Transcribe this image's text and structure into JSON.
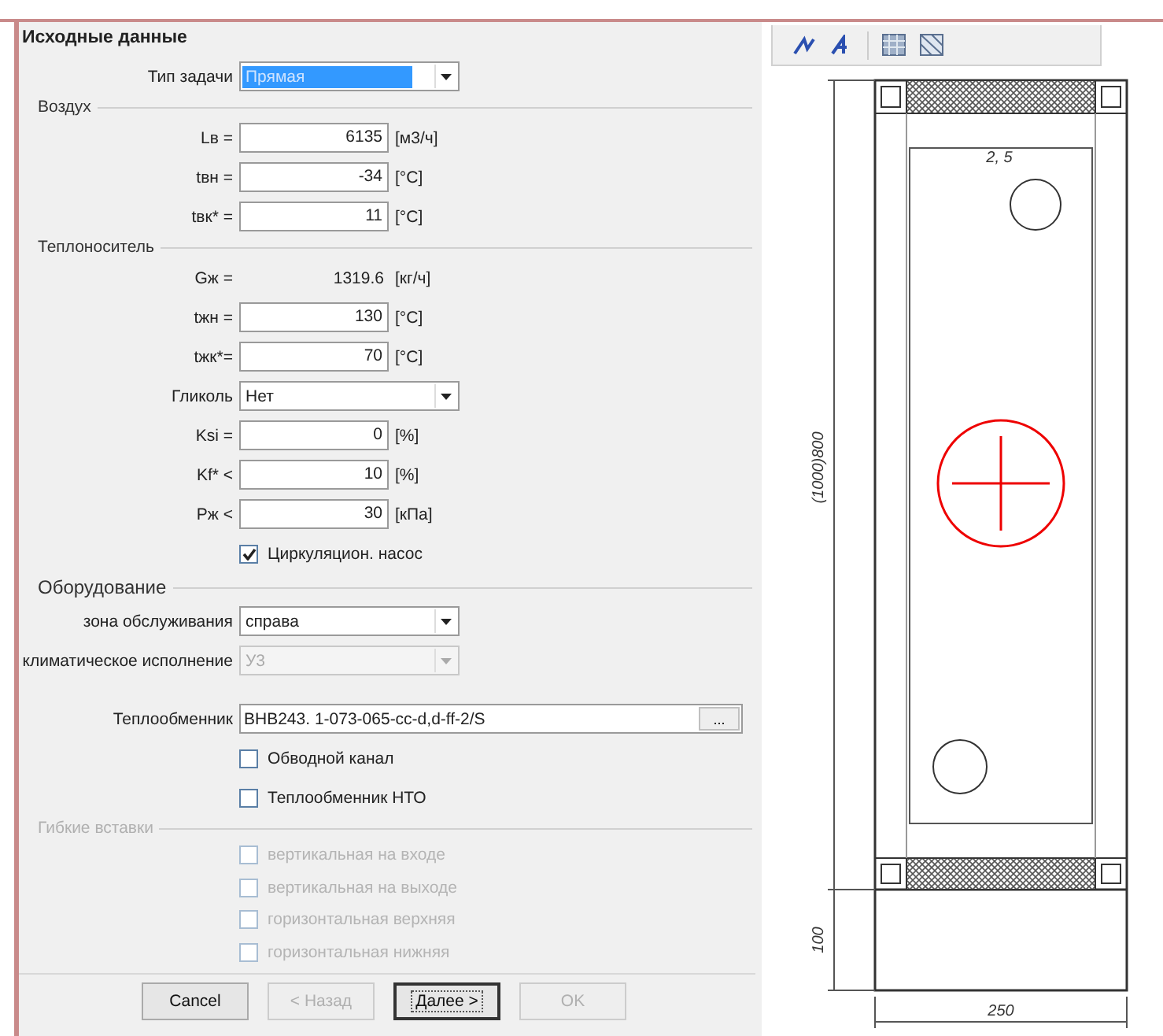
{
  "title": "Исходные данные",
  "rows": [
    {
      "kind": "combo",
      "label": "Тип задачи",
      "value": "Прямая",
      "focused": true,
      "disabled": false
    },
    {
      "kind": "group",
      "label": "Воздух",
      "disabled": false,
      "large": false
    },
    {
      "kind": "input",
      "label": "Lв =",
      "value": "6135",
      "unit": "[м3/ч]"
    },
    {
      "kind": "input",
      "label": "tвн =",
      "value": "-34",
      "unit": "[°C]"
    },
    {
      "kind": "input",
      "label": "tвк* =",
      "value": "11",
      "unit": "[°C]"
    },
    {
      "kind": "group",
      "label": "Теплоноситель",
      "disabled": false,
      "large": false
    },
    {
      "kind": "static",
      "label": "Gж =",
      "value": "1319.6",
      "unit": "[кг/ч]"
    },
    {
      "kind": "input",
      "label": "tжн =",
      "value": "130",
      "unit": "[°C]"
    },
    {
      "kind": "input",
      "label": "tжк*=",
      "value": "70",
      "unit": "[°C]"
    },
    {
      "kind": "combo",
      "label": "Гликоль",
      "value": "Нет",
      "focused": false,
      "disabled": false
    },
    {
      "kind": "input",
      "label": "Ksi =",
      "value": "0",
      "unit": "[%]"
    },
    {
      "kind": "input",
      "label": "Kf* <",
      "value": "10",
      "unit": "[%]"
    },
    {
      "kind": "input",
      "label": "Pж <",
      "value": "30",
      "unit": "[кПа]"
    },
    {
      "kind": "checkbox",
      "label": "Циркуляцион. насос",
      "checked": true,
      "disabled": false
    },
    {
      "kind": "group",
      "label": "Оборудование",
      "disabled": false,
      "large": true
    },
    {
      "kind": "combo",
      "label": "зона обслуживания",
      "value": "справа",
      "focused": false,
      "disabled": false
    },
    {
      "kind": "combo",
      "label": "климатическое исполнение",
      "value": "У3",
      "focused": false,
      "disabled": true
    },
    {
      "kind": "file",
      "label": "Теплообменник",
      "value": "ВНВ243. 1-073-065-cc-d,d-ff-2/S",
      "button": "..."
    },
    {
      "kind": "checkbox",
      "label": "Обводной канал",
      "checked": false,
      "disabled": false
    },
    {
      "kind": "checkbox",
      "label": "Теплообменник НТО",
      "checked": false,
      "disabled": false
    },
    {
      "kind": "group",
      "label": "Гибкие вставки",
      "disabled": true,
      "large": false
    },
    {
      "kind": "checkbox",
      "label": "вертикальная на входе",
      "checked": false,
      "disabled": true
    },
    {
      "kind": "checkbox",
      "label": "вертикальная на выходе",
      "checked": false,
      "disabled": true
    },
    {
      "kind": "checkbox",
      "label": "горизонтальная верхняя",
      "checked": false,
      "disabled": true
    },
    {
      "kind": "checkbox",
      "label": "горизонтальная нижняя",
      "checked": false,
      "disabled": true
    }
  ],
  "buttons": [
    {
      "label": "Cancel",
      "disabled": false,
      "default": false
    },
    {
      "label": "< Назад",
      "disabled": true,
      "default": false
    },
    {
      "label": "Далее >",
      "disabled": false,
      "default": true
    },
    {
      "label": "OK",
      "disabled": true,
      "default": false
    }
  ],
  "drawing": {
    "top_label": "2, 5",
    "height_label": "(1000)800",
    "base_label": "100",
    "width_label": "250"
  }
}
